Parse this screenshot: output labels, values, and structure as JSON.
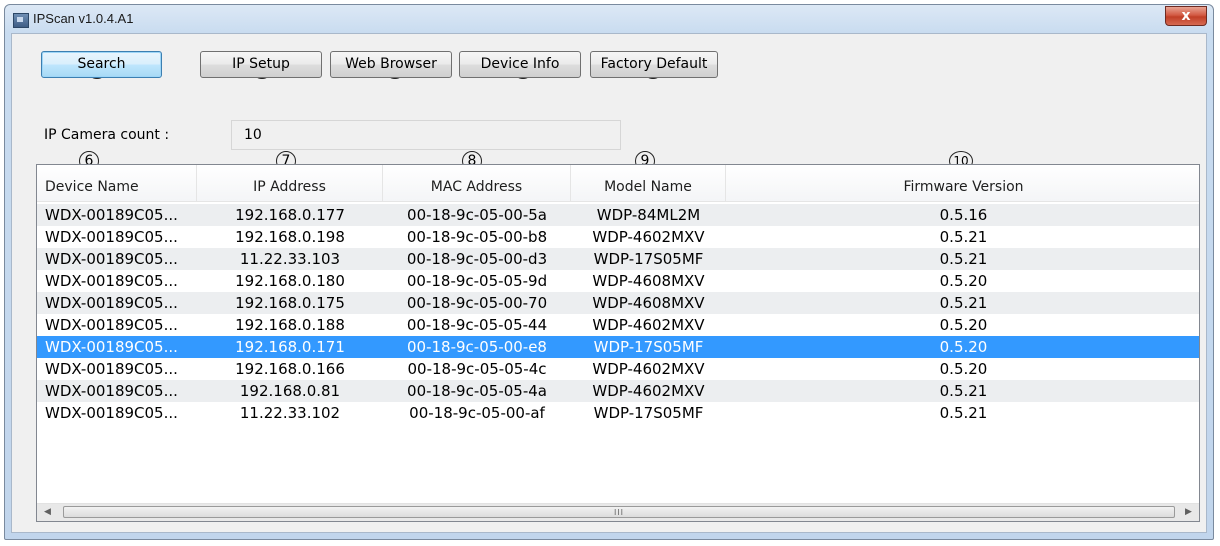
{
  "window": {
    "title": "IPScan v1.0.4.A1",
    "close_glyph": "x"
  },
  "callouts": [
    "1",
    "2",
    "3",
    "4",
    "5",
    "6",
    "7",
    "8",
    "9",
    "10"
  ],
  "toolbar": {
    "search_label": "Search",
    "ip_setup_label": "IP Setup",
    "web_browser_label": "Web Browser",
    "device_info_label": "Device Info",
    "factory_default_label": "Factory Default"
  },
  "count": {
    "label": "IP Camera count :",
    "value": "10"
  },
  "table": {
    "columns": [
      "Device Name",
      "IP Address",
      "MAC Address",
      "Model Name",
      "Firmware Version"
    ],
    "rows": [
      [
        "WDX-00189C05...",
        "192.168.0.177",
        "00-18-9c-05-00-5a",
        "WDP-84ML2M",
        "0.5.16"
      ],
      [
        "WDX-00189C05...",
        "192.168.0.198",
        "00-18-9c-05-00-b8",
        "WDP-4602MXV",
        "0.5.21"
      ],
      [
        "WDX-00189C05...",
        "11.22.33.103",
        "00-18-9c-05-00-d3",
        "WDP-17S05MF",
        "0.5.21"
      ],
      [
        "WDX-00189C05...",
        "192.168.0.180",
        "00-18-9c-05-05-9d",
        "WDP-4608MXV",
        "0.5.20"
      ],
      [
        "WDX-00189C05...",
        "192.168.0.175",
        "00-18-9c-05-00-70",
        "WDP-4608MXV",
        "0.5.21"
      ],
      [
        "WDX-00189C05...",
        "192.168.0.188",
        "00-18-9c-05-05-44",
        "WDP-4602MXV",
        "0.5.20"
      ],
      [
        "WDX-00189C05...",
        "192.168.0.171",
        "00-18-9c-05-00-e8",
        "WDP-17S05MF",
        "0.5.20"
      ],
      [
        "WDX-00189C05...",
        "192.168.0.166",
        "00-18-9c-05-05-4c",
        "WDP-4602MXV",
        "0.5.20"
      ],
      [
        "WDX-00189C05...",
        "192.168.0.81",
        "00-18-9c-05-05-4a",
        "WDP-4602MXV",
        "0.5.21"
      ],
      [
        "WDX-00189C05...",
        "11.22.33.102",
        "00-18-9c-05-00-af",
        "WDP-17S05MF",
        "0.5.21"
      ]
    ],
    "selected_row": 7,
    "selection_color": "#3399ff"
  },
  "scrollbar": {
    "left_arrow": "◀",
    "right_arrow": "▶",
    "grip": "III"
  },
  "icons": {
    "app": "app-window-icon",
    "close": "close-icon"
  }
}
